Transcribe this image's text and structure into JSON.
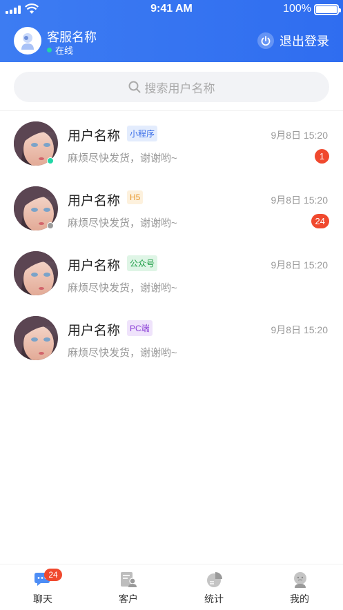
{
  "status_bar": {
    "time": "9:41 AM",
    "battery": "100%"
  },
  "header": {
    "agent_name": "客服名称",
    "agent_status": "在线",
    "logout_label": "退出登录"
  },
  "search": {
    "placeholder": "搜索用户名称"
  },
  "conversations": [
    {
      "name": "用户名称",
      "tag": "小程序",
      "time": "9月8日  15:20",
      "message": "麻烦尽快发货，谢谢哟~",
      "unread": "1",
      "presence": "online"
    },
    {
      "name": "用户名称",
      "tag": "H5",
      "time": "9月8日  15:20",
      "message": "麻烦尽快发货，谢谢哟~",
      "unread": "24",
      "presence": "offline"
    },
    {
      "name": "用户名称",
      "tag": "公众号",
      "time": "9月8日  15:20",
      "message": "麻烦尽快发货，谢谢哟~",
      "unread": "",
      "presence": "none"
    },
    {
      "name": "用户名称",
      "tag": "PC端",
      "time": "9月8日  15:20",
      "message": "麻烦尽快发货，谢谢哟~",
      "unread": "",
      "presence": "none"
    }
  ],
  "tabbar": {
    "items": [
      {
        "label": "聊天",
        "icon": "chat-icon",
        "badge": "24",
        "active": true
      },
      {
        "label": "客户",
        "icon": "customer-icon"
      },
      {
        "label": "统计",
        "icon": "stats-icon"
      },
      {
        "label": "我的",
        "icon": "profile-icon"
      }
    ]
  },
  "colors": {
    "header_blue": "#3d7cf2",
    "badge_red": "#f0492e",
    "online_green": "#21d6a6",
    "offline_gray": "#9a9a9a",
    "tag_mini": "#3a6ee8",
    "tag_h5": "#e8972b",
    "tag_mp": "#1e9e46",
    "tag_pc": "#8a3fd6"
  }
}
